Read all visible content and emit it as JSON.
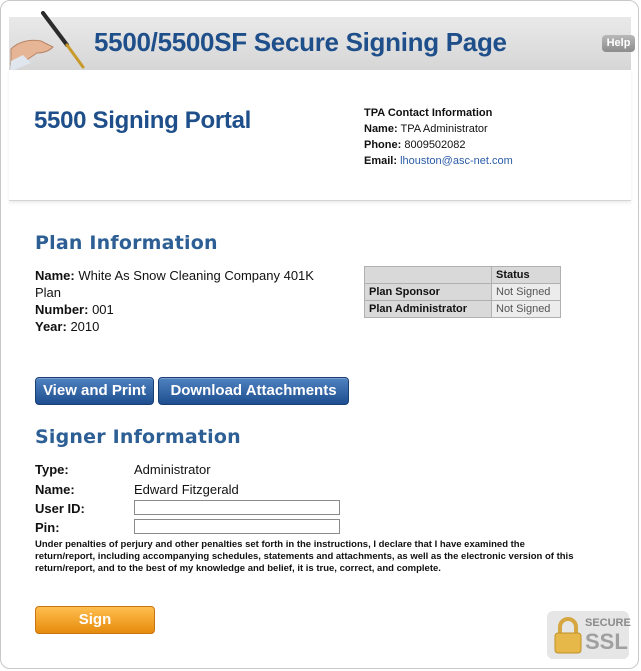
{
  "header": {
    "title": "5500/5500SF Secure Signing Page",
    "help_label": "Help"
  },
  "portal": {
    "title": "5500 Signing Portal",
    "tpa": {
      "heading": "TPA Contact Information",
      "name_label": "Name:",
      "name_value": "TPA Administrator",
      "phone_label": "Phone:",
      "phone_value": "8009502082",
      "email_label": "Email:",
      "email_value": "lhouston@asc-net.com"
    }
  },
  "plan": {
    "title": "Plan Information",
    "name_label": "Name:",
    "name_value": "White As Snow Cleaning Company 401K Plan",
    "number_label": "Number:",
    "number_value": "001",
    "year_label": "Year:",
    "year_value": "2010",
    "status_header": "Status",
    "rows": [
      {
        "label": "Plan Sponsor",
        "status": "Not Signed"
      },
      {
        "label": "Plan Administrator",
        "status": "Not Signed"
      }
    ]
  },
  "actions": {
    "view_print": "View and Print",
    "download": "Download Attachments"
  },
  "signer": {
    "title": "Signer Information",
    "type_label": "Type:",
    "type_value": "Administrator",
    "name_label": "Name:",
    "name_value": "Edward Fitzgerald",
    "userid_label": "User ID:",
    "userid_value": "",
    "pin_label": "Pin:",
    "pin_value": ""
  },
  "legal": "Under penalties of perjury and other penalties set forth in the instructions, I declare that I have examined the return/report, including accompanying schedules, statements and attachments, as well as the electronic version of this return/report, and to the best of my knowledge and belief, it is true, correct, and complete.",
  "sign_label": "Sign",
  "ssl": {
    "line1": "SECURE",
    "line2": "SSL"
  },
  "colors": {
    "brand_blue": "#1f4f8a",
    "sign_orange": "#f5a02a"
  }
}
